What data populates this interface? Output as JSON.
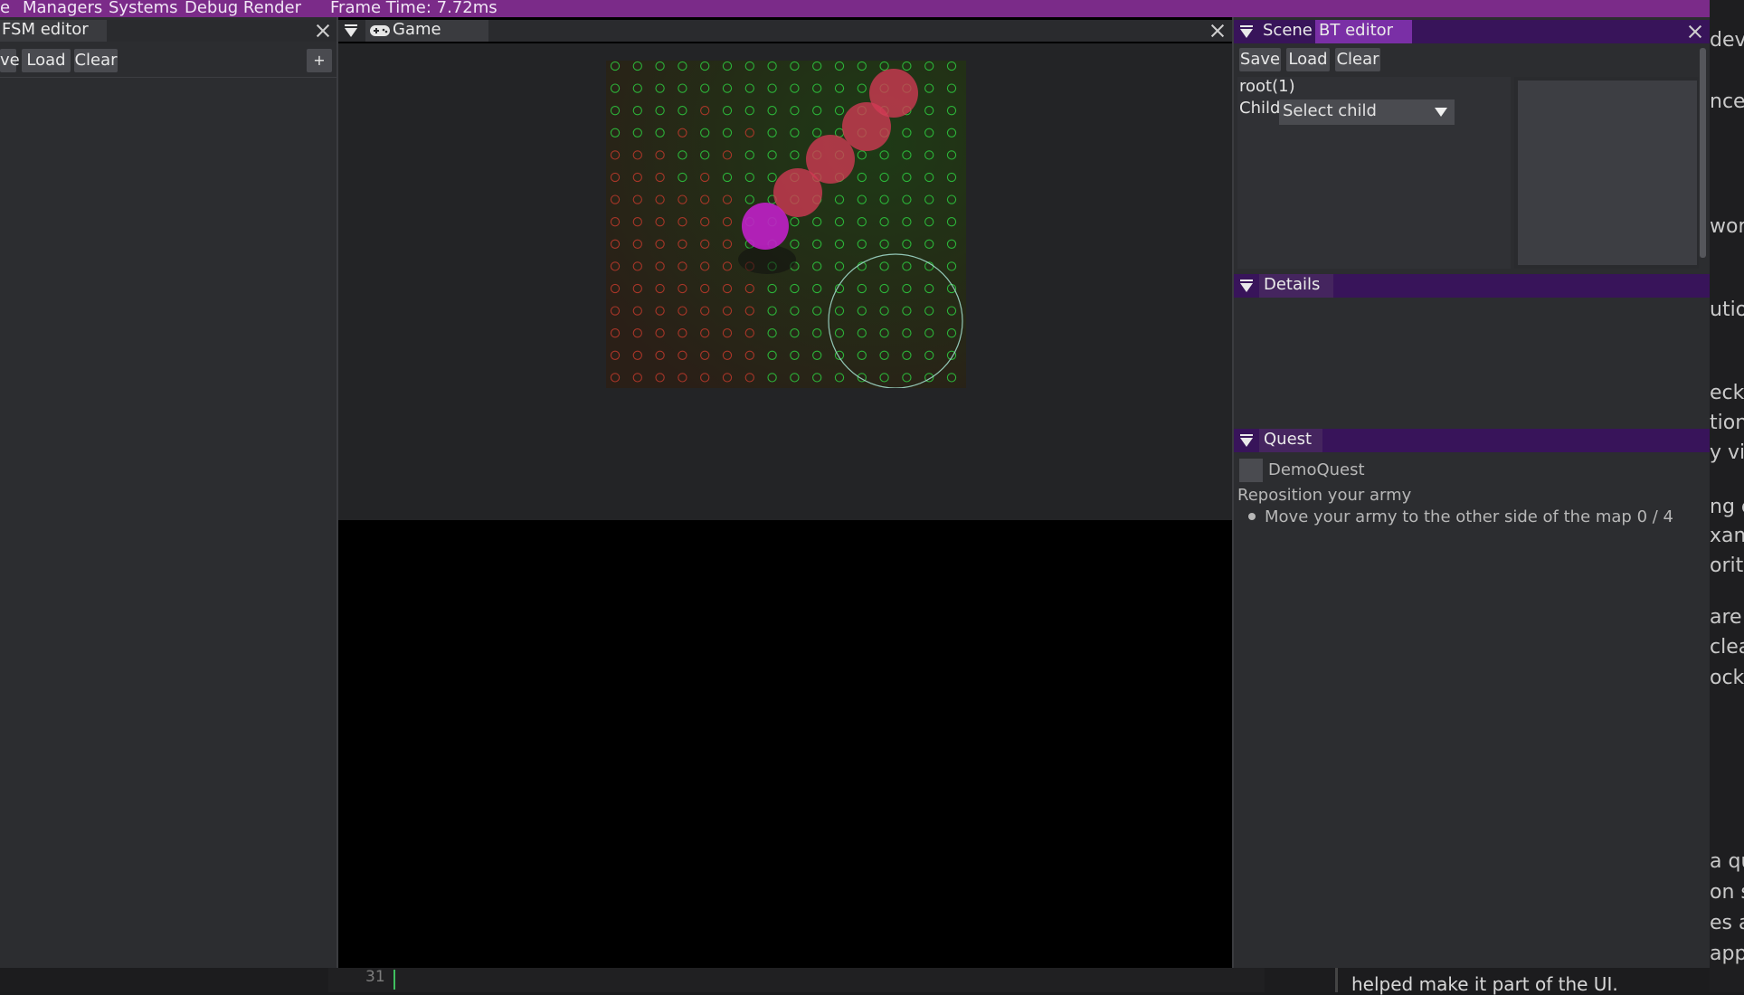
{
  "menubar": {
    "items": [
      "e",
      "Managers",
      "Systems",
      "Debug Render"
    ],
    "frame_time": "Frame Time: 7.72ms"
  },
  "fsm": {
    "title": "FSM editor",
    "buttons": [
      "ve",
      "Load",
      "Clear"
    ],
    "add_label": "+"
  },
  "game": {
    "title": "Game"
  },
  "bt": {
    "tab_scene": "Scene",
    "tab_bt": "BT editor",
    "buttons": [
      "Save",
      "Load",
      "Clear"
    ],
    "root_label": "root(1)",
    "child_label": "Child",
    "select_value": "Select child"
  },
  "details": {
    "title": "Details"
  },
  "quest": {
    "title": "Quest",
    "name": "DemoQuest",
    "description": "Reposition your army",
    "objective": "Move your army to the other side of the map 0 / 4"
  },
  "bottom": {
    "line_number": "31",
    "snippet": "helped make it part of the UI."
  },
  "right_fragments": [
    "deve",
    "ncep",
    "work",
    "utio",
    "ecke",
    "tions",
    "y visi",
    "ng e",
    "xamp",
    "orithi",
    "are t",
    "clea",
    "ock.",
    "a qu",
    "on s",
    "es ar",
    "app"
  ],
  "colors": {
    "menubar": "#7b2b89",
    "tab_active": "#7a2fa6",
    "tabbar": "#38145a",
    "panel": "#2c2d30",
    "game_bg": "#232426",
    "grid_green": "#2ecc40",
    "grid_red": "#c0392b",
    "unit_red": "#d23a55",
    "unit_magenta": "#c020c8"
  }
}
